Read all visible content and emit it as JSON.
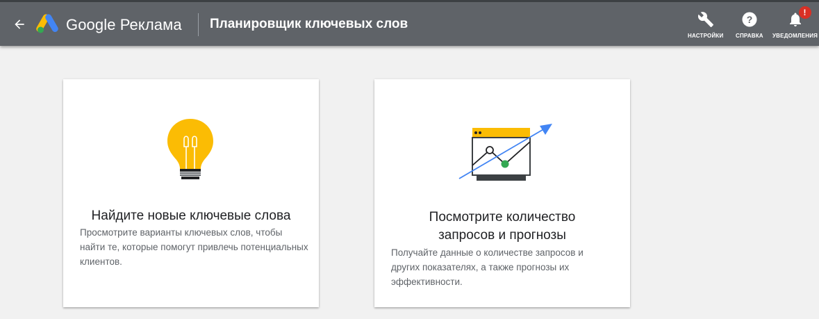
{
  "header": {
    "brand": "Google Реклама",
    "title": "Планировщик ключевых слов",
    "tools": [
      {
        "label": "НАСТРОЙКИ",
        "icon": "wrench-icon"
      },
      {
        "label": "СПРАВКА",
        "icon": "help-icon"
      },
      {
        "label": "УВЕДОМЛЕНИЯ",
        "icon": "bell-icon",
        "badge": "!"
      }
    ]
  },
  "cards": [
    {
      "title": "Найдите новые ключевые слова",
      "description": "Просмотрите варианты ключевых слов, чтобы найти те, которые помогут привлечь потенциальных клиентов.",
      "icon": "lightbulb-icon"
    },
    {
      "title": "Посмотрите количество запросов и прогнозы",
      "description": "Получайте данные о количестве запросов и других показателях, а также прогнозы их эффективности.",
      "icon": "forecast-chart-icon"
    }
  ],
  "colors": {
    "header_bg": "#5f6368",
    "page_bg": "#f1f1f1",
    "bulb_yellow": "#fbbc04",
    "arrow_blue": "#4285f4",
    "point_green": "#34a853",
    "badge_red": "#d93025"
  }
}
